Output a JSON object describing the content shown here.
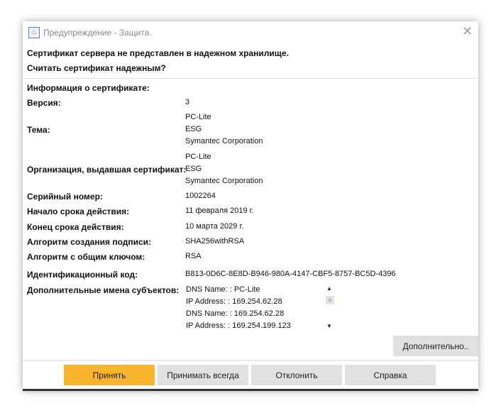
{
  "title": "Предупреждение - Защита.",
  "header": {
    "line1": "Сертификат сервера не представлен в надежном хранилище.",
    "line2": "Считать сертификат надежным?"
  },
  "info_heading": "Информация о сертификате:",
  "fields": {
    "version": {
      "label": "Версия:",
      "value": "3"
    },
    "subject": {
      "label": "Тема:",
      "values": [
        "PC-Lite",
        "ESG",
        "Symantec Corporation"
      ]
    },
    "issuer": {
      "label": "Организация, выдавшая сертификат:",
      "values": [
        "PC-Lite",
        "ESG",
        "Symantec Corporation"
      ]
    },
    "serial": {
      "label": "Серийный номер:",
      "value": "1002264"
    },
    "valid_from": {
      "label": "Начало срока действия:",
      "value": "11 февраля 2019 г."
    },
    "valid_to": {
      "label": "Конец срока действия:",
      "value": "10 марта 2029 г."
    },
    "sig_alg": {
      "label": "Алгоритм создания подписи:",
      "value": "SHA256withRSA"
    },
    "key_alg": {
      "label": "Алгоритм с общим ключом:",
      "value": "RSA"
    },
    "fingerprint": {
      "label": "Идентификационный код:",
      "value": "B813-0D6C-8E8D-B946-980A-4147-CBF5-8757-BC5D-4396"
    },
    "san": {
      "label": "Дополнительные имена субъектов:",
      "values": [
        "DNS Name: : PC-Lite",
        "IP Address: : 169.254.62.28",
        "DNS Name: : 169.254.62.28",
        "IP Address: : 169.254.199.123"
      ]
    }
  },
  "more_button": "Дополнительно..",
  "buttons": {
    "accept": "Принять",
    "always": "Принимать всегда",
    "reject": "Отклонить",
    "help": "Справка"
  },
  "colors": {
    "accent": "#f9b52e"
  }
}
